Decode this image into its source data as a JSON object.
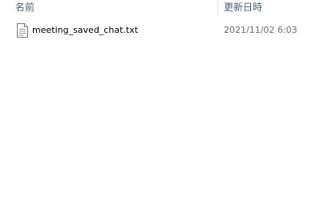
{
  "columns": {
    "name_label": "名前",
    "date_label": "更新日時"
  },
  "files": [
    {
      "name": "meeting_saved_chat.txt",
      "modified": "2021/11/02 6:03",
      "icon": "text-file-icon"
    }
  ],
  "colors": {
    "header_text": "#4c607a",
    "date_text": "#6d6d6d"
  }
}
